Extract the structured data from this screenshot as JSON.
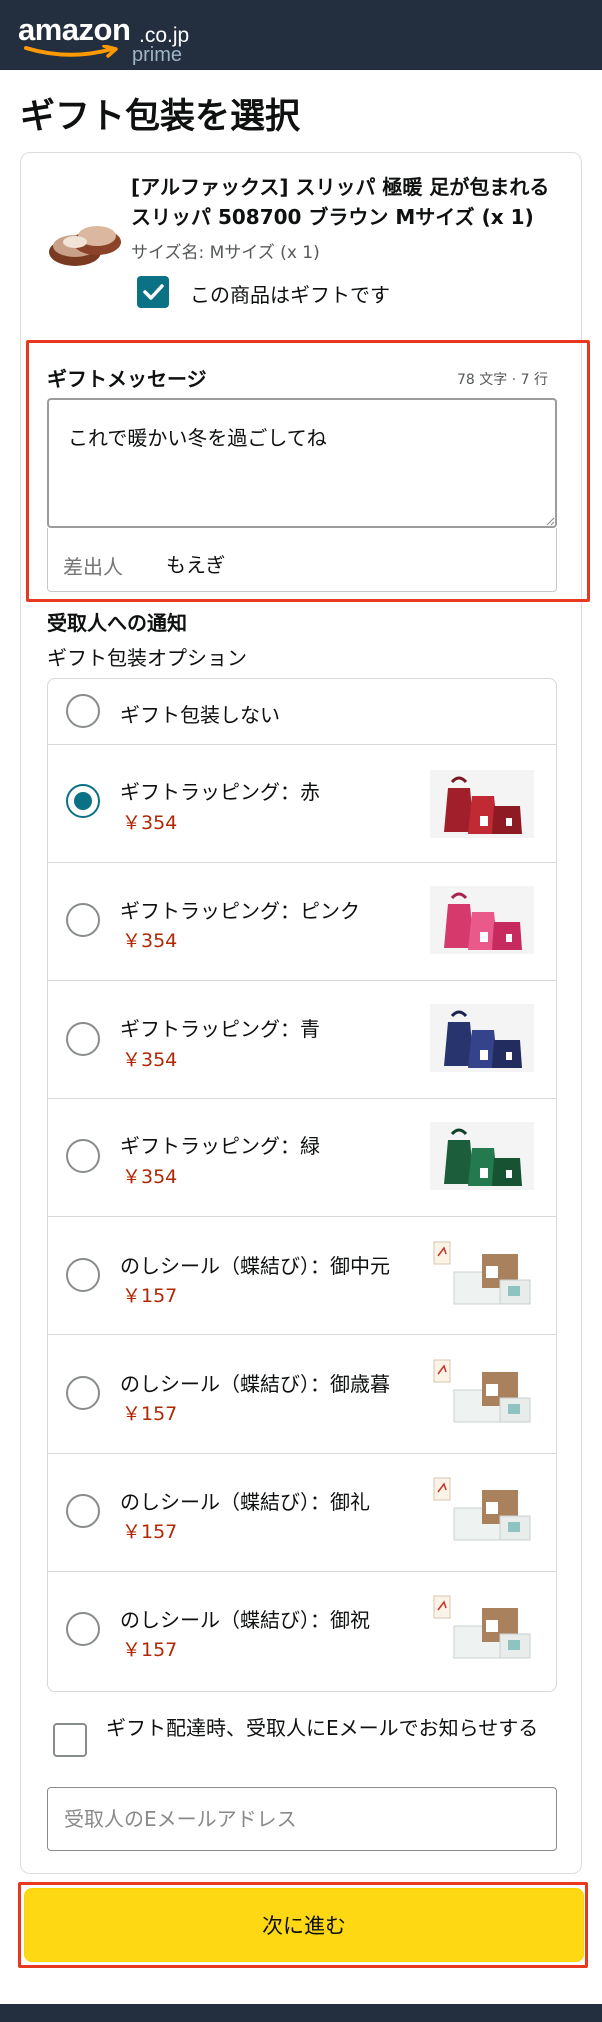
{
  "header": {
    "logo_word": "amazon",
    "logo_tld": ".co.jp",
    "logo_sub": "prime"
  },
  "page": {
    "title": "ギフト包装を選択"
  },
  "product": {
    "title": "[アルファックス] スリッパ 極暖 足が包まれるスリッパ 508700 ブラウン Mサイズ (x 1)",
    "size": "サイズ名: Mサイズ (x 1)",
    "gift_checkbox_label": "この商品はギフトです",
    "is_gift": true
  },
  "message": {
    "label": "ギフトメッセージ",
    "counter": "78 文字 · 7 行",
    "text": "これで暖かい冬を過ごしてね",
    "sender_label": "差出人",
    "sender_value": "もえぎ"
  },
  "wrapping": {
    "notify_title": "受取人への通知",
    "options_title": "ギフト包装オプション",
    "options": [
      {
        "label": "ギフト包装しない",
        "price": "",
        "selected": false,
        "image": "none"
      },
      {
        "label": "ギフトラッピング：赤",
        "price": "￥354",
        "selected": true,
        "image": "red-gift-bags",
        "color": "#b3262e"
      },
      {
        "label": "ギフトラッピング：ピンク",
        "price": "￥354",
        "selected": false,
        "image": "pink-gift-bags",
        "color": "#e0457b"
      },
      {
        "label": "ギフトラッピング：青",
        "price": "￥354",
        "selected": false,
        "image": "blue-gift-bags",
        "color": "#2b3a7d"
      },
      {
        "label": "ギフトラッピング：緑",
        "price": "￥354",
        "selected": false,
        "image": "green-gift-bags",
        "color": "#1f6b45"
      },
      {
        "label": "のしシール（蝶結び）：御中元",
        "price": "￥157",
        "selected": false,
        "image": "noshi-seal"
      },
      {
        "label": "のしシール（蝶結び）：御歳暮",
        "price": "￥157",
        "selected": false,
        "image": "noshi-seal"
      },
      {
        "label": "のしシール（蝶結び）：御礼",
        "price": "￥157",
        "selected": false,
        "image": "noshi-seal"
      },
      {
        "label": "のしシール（蝶結び）：御祝",
        "price": "￥157",
        "selected": false,
        "image": "noshi-seal"
      }
    ]
  },
  "email": {
    "checkbox_label": "ギフト配達時、受取人にEメールでお知らせする",
    "checked": false,
    "placeholder": "受取人のEメールアドレス"
  },
  "footer": {
    "next_button": "次に進む"
  },
  "colors": {
    "header_bg": "#232f3e",
    "accent_teal": "#0b7184",
    "price_red": "#b12704",
    "button_yellow": "#ffd814",
    "highlight_frame": "#e8381f"
  }
}
